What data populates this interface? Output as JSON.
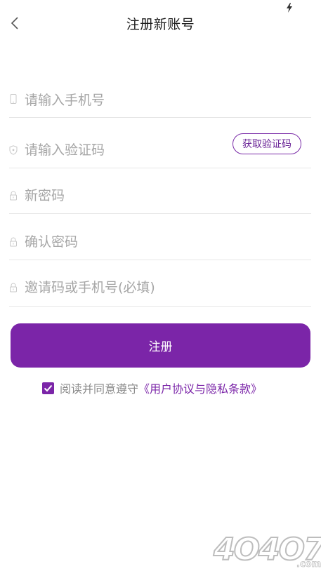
{
  "header": {
    "title": "注册新账号"
  },
  "form": {
    "phone_placeholder": "请输入手机号",
    "code_placeholder": "请输入验证码",
    "get_code_label": "获取验证码",
    "new_password_placeholder": "新密码",
    "confirm_password_placeholder": "确认密码",
    "invite_placeholder": "邀请码或手机号(必填)"
  },
  "submit_label": "注册",
  "agreement": {
    "checked": true,
    "prefix": "阅读并同意遵守",
    "link": "《用户协议与隐私条款》"
  },
  "watermark": {
    "text": "4O4O7",
    "suffix": ".com"
  },
  "colors": {
    "accent": "#7b25a8",
    "placeholder": "#a6a6a6",
    "divider": "#e6e6e6"
  }
}
